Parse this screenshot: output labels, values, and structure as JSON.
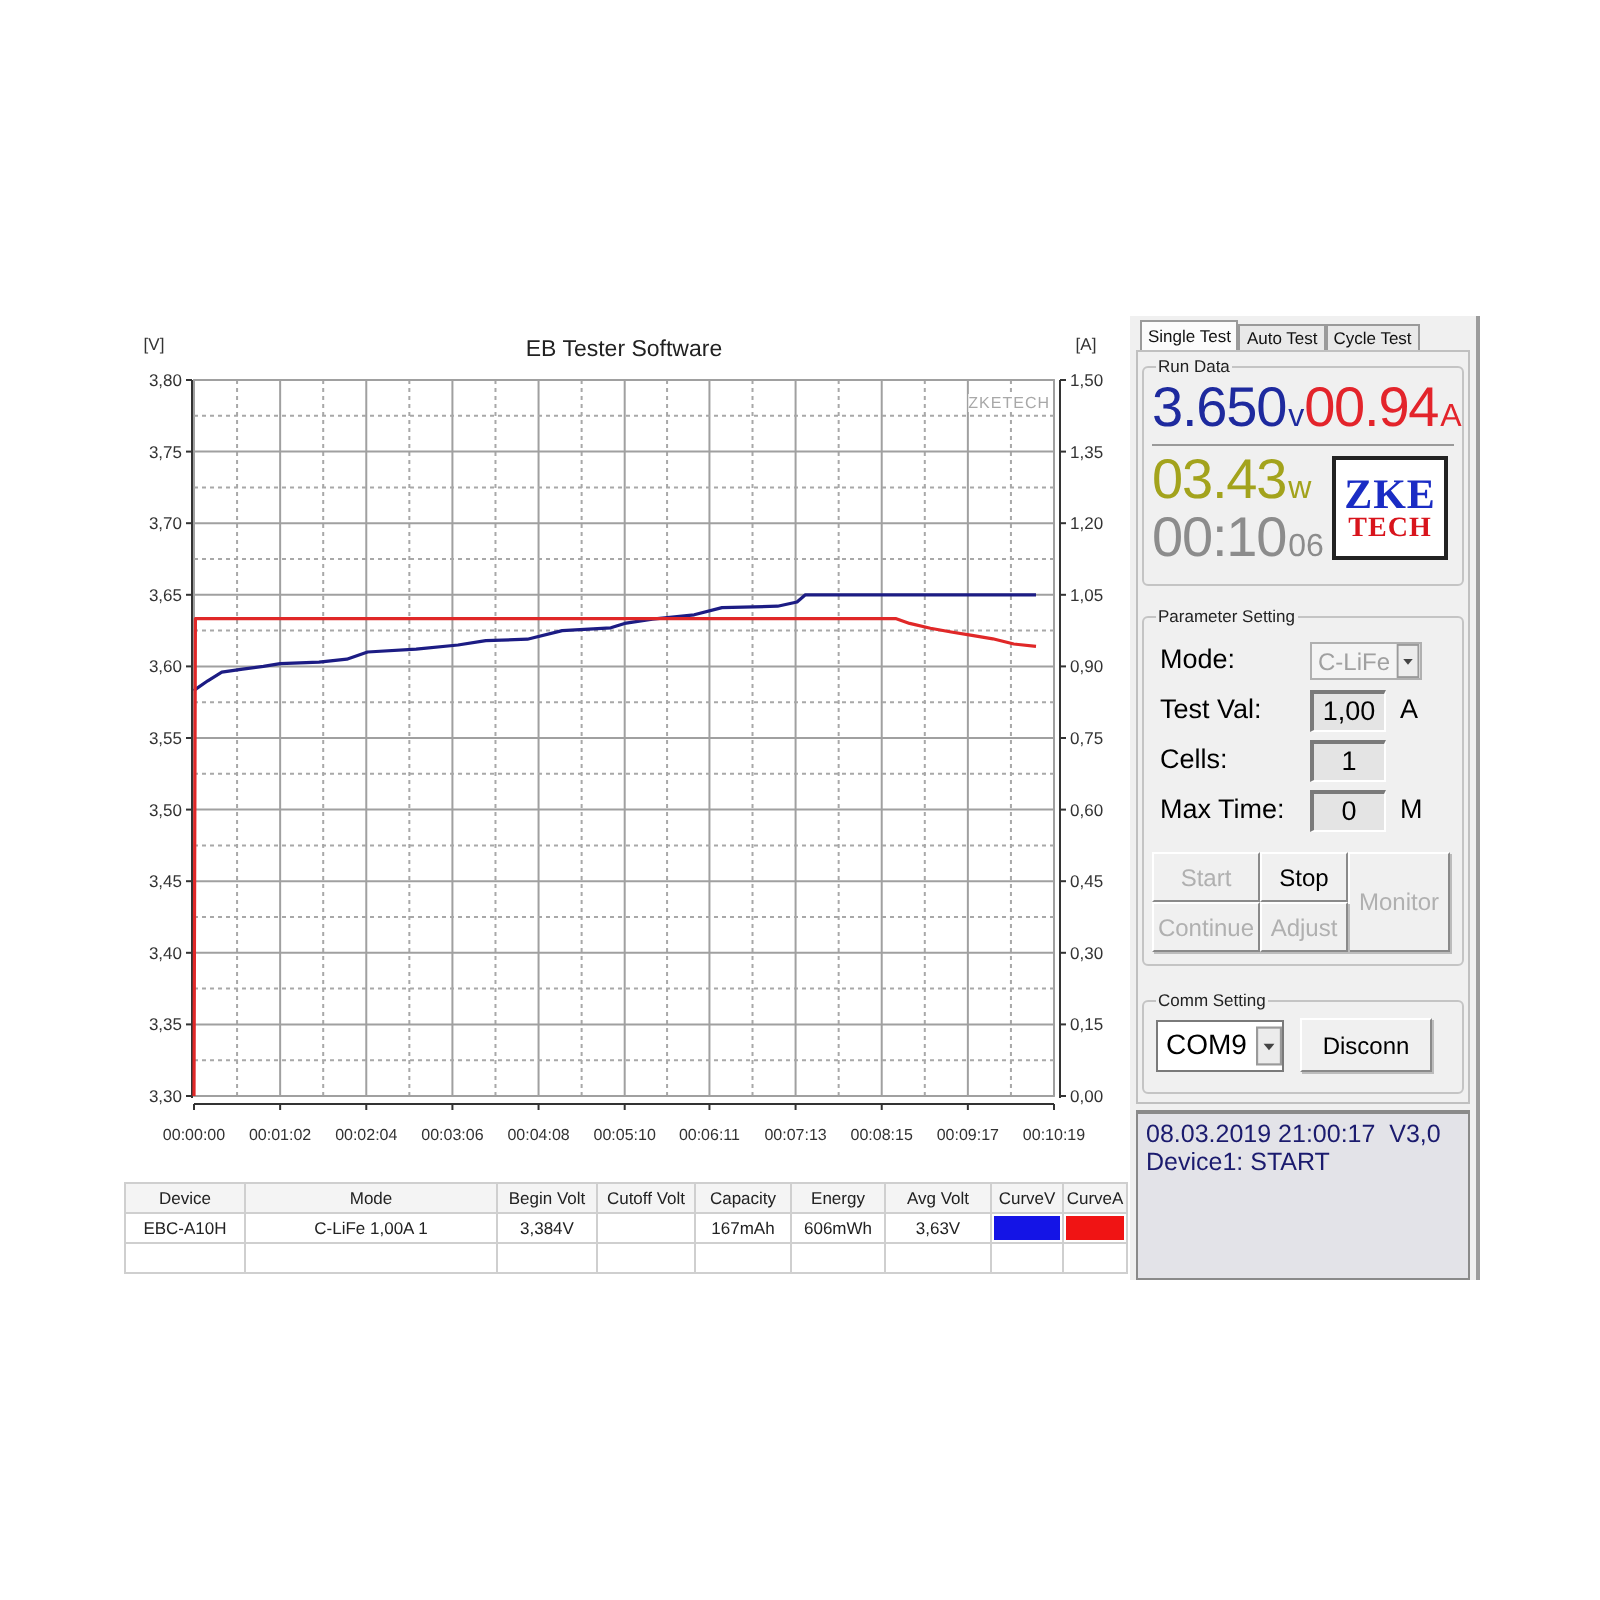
{
  "chart": {
    "brand_label": "ZKETECH",
    "chart_data": {
      "type": "line",
      "title": "EB Tester Software",
      "ylabel": "[V]",
      "y2label": "[A]",
      "grid": true,
      "x": [
        0,
        1,
        10,
        20,
        35,
        50,
        62,
        90,
        110,
        125,
        160,
        190,
        210,
        240,
        265,
        300,
        310,
        330,
        360,
        380,
        420,
        434,
        440,
        505,
        515,
        530,
        545,
        560,
        575,
        590,
        606
      ],
      "xlim": [
        0,
        619
      ],
      "xticks": [
        {
          "value": 0,
          "label": "00:00:00"
        },
        {
          "value": 62,
          "label": "00:01:02"
        },
        {
          "value": 124,
          "label": "00:02:04"
        },
        {
          "value": 186,
          "label": "00:03:06"
        },
        {
          "value": 248,
          "label": "00:04:08"
        },
        {
          "value": 310,
          "label": "00:05:10"
        },
        {
          "value": 371,
          "label": "00:06:11"
        },
        {
          "value": 433,
          "label": "00:07:13"
        },
        {
          "value": 495,
          "label": "00:08:15"
        },
        {
          "value": 557,
          "label": "00:09:17"
        },
        {
          "value": 619,
          "label": "00:10:19"
        }
      ],
      "ylim": [
        3.3,
        3.8
      ],
      "yticks": [
        {
          "value": 3.8,
          "label": "3,80"
        },
        {
          "value": 3.75,
          "label": "3,75"
        },
        {
          "value": 3.7,
          "label": "3,70"
        },
        {
          "value": 3.65,
          "label": "3,65"
        },
        {
          "value": 3.6,
          "label": "3,60"
        },
        {
          "value": 3.55,
          "label": "3,55"
        },
        {
          "value": 3.5,
          "label": "3,50"
        },
        {
          "value": 3.45,
          "label": "3,45"
        },
        {
          "value": 3.4,
          "label": "3,40"
        },
        {
          "value": 3.35,
          "label": "3,35"
        },
        {
          "value": 3.3,
          "label": "3,30"
        }
      ],
      "y2lim": [
        0,
        1.5
      ],
      "y2ticks": [
        {
          "value": 1.5,
          "label": "1,50"
        },
        {
          "value": 1.35,
          "label": "1,35"
        },
        {
          "value": 1.2,
          "label": "1,20"
        },
        {
          "value": 1.05,
          "label": "1,05"
        },
        {
          "value": 0.9,
          "label": "0,90"
        },
        {
          "value": 0.75,
          "label": "0,75"
        },
        {
          "value": 0.6,
          "label": "0,60"
        },
        {
          "value": 0.45,
          "label": "0,45"
        },
        {
          "value": 0.3,
          "label": "0,30"
        },
        {
          "value": 0.15,
          "label": "0,15"
        },
        {
          "value": 0,
          "label": "0,00"
        }
      ],
      "series": [
        {
          "color": "#1c1c84",
          "values": [
            3.583,
            3.584,
            3.59,
            3.596,
            3.598,
            3.6,
            3.602,
            3.603,
            3.605,
            3.61,
            3.612,
            3.615,
            3.618,
            3.619,
            3.625,
            3.627,
            3.63,
            3.633,
            3.636,
            3.641,
            3.642,
            3.645,
            3.65,
            3.65,
            3.65,
            3.65,
            3.65,
            3.65,
            3.65,
            3.65,
            3.65
          ]
        },
        {
          "axis": "y2",
          "color": "#e02828",
          "values": [
            0,
            1,
            1,
            1,
            1,
            1,
            1,
            1,
            1,
            1,
            1,
            1,
            1,
            1,
            1,
            1,
            1,
            1,
            1,
            1,
            1,
            1,
            1,
            1,
            0.99,
            0.98,
            0.972,
            0.965,
            0.958,
            0.947,
            0.942
          ]
        }
      ]
    }
  },
  "results_table": {
    "columns": [
      "Device",
      "Mode",
      "Begin Volt",
      "Cutoff Volt",
      "Capacity",
      "Energy",
      "Avg Volt",
      "CurveV",
      "CurveA"
    ],
    "rows": [
      {
        "cells": [
          {
            "kind": "text",
            "text": "EBC-A10H"
          },
          {
            "kind": "text",
            "text": "C-LiFe 1,00A 1"
          },
          {
            "kind": "text",
            "text": "3,384V"
          },
          {
            "kind": "empty"
          },
          {
            "kind": "text",
            "text": "167mAh"
          },
          {
            "kind": "text",
            "text": "606mWh"
          },
          {
            "kind": "text",
            "text": "3,63V"
          },
          {
            "kind": "swatch",
            "color": "#1414e6"
          },
          {
            "kind": "swatch",
            "color": "#f01414"
          }
        ]
      },
      {
        "cells": [
          {
            "kind": "empty"
          },
          {
            "kind": "empty"
          },
          {
            "kind": "empty"
          },
          {
            "kind": "empty"
          },
          {
            "kind": "empty"
          },
          {
            "kind": "empty"
          },
          {
            "kind": "empty"
          },
          {
            "kind": "empty"
          },
          {
            "kind": "empty"
          }
        ]
      }
    ]
  },
  "side_panel": {
    "tabs": [
      {
        "label": "Single Test",
        "selected": true
      },
      {
        "label": "Auto Test",
        "selected": false
      },
      {
        "label": "Cycle Test",
        "selected": false
      }
    ],
    "run_data": {
      "title": "Run Data",
      "readings": [
        {
          "value": "3.650",
          "suffix": "v",
          "color": "#1e2a9e"
        },
        {
          "value": "00.94",
          "suffix": "A",
          "color": "#e3242b"
        },
        {
          "value": "03.43",
          "suffix": "w",
          "color": "#a3a31c"
        },
        {
          "value": "00:10",
          "suffix": "06",
          "color": "#8c8c8c"
        }
      ],
      "logo": {
        "top_text": "ZKE",
        "bottom_text": "TECH"
      }
    },
    "parameter_setting": {
      "title": "Parameter Setting",
      "fields": [
        {
          "kind": "select",
          "label": "Mode:",
          "value": "C-LiFe",
          "disabled": true
        },
        {
          "kind": "input",
          "label": "Test Val:",
          "value": "1,00",
          "unit": "A",
          "disabled": false
        },
        {
          "kind": "input",
          "label": "Cells:",
          "value": "1",
          "disabled": false
        },
        {
          "kind": "input",
          "label": "Max Time:",
          "value": "0",
          "unit": "M",
          "disabled": false
        }
      ],
      "buttons": [
        {
          "label": "Start",
          "kind": "normal",
          "disabled": true
        },
        {
          "label": "Stop",
          "kind": "normal",
          "disabled": false
        },
        {
          "label": "Monitor",
          "kind": "tall",
          "disabled": true
        },
        {
          "label": "Continue",
          "kind": "normal",
          "disabled": true
        },
        {
          "label": "Adjust",
          "kind": "normal",
          "disabled": true
        }
      ]
    },
    "comm_setting": {
      "title": "Comm Setting",
      "port": {
        "value": "COM9"
      },
      "button": {
        "label": "Disconn"
      }
    },
    "status_log": {
      "lines": [
        "08.03.2019 21:00:17  V3,0",
        "Device1: START"
      ]
    }
  }
}
